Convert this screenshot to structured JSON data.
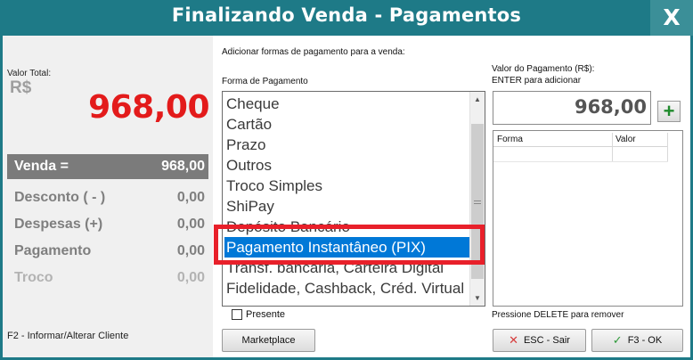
{
  "window": {
    "title": "Finalizando Venda - Pagamentos",
    "close_label": "X",
    "accent_color": "#1e7a87"
  },
  "left": {
    "total_label": "Valor Total:",
    "currency": "R$",
    "total_value": "968,00",
    "venda": {
      "label": "Venda =",
      "value": "968,00"
    },
    "desconto": {
      "label": "Desconto ( - )",
      "value": "0,00"
    },
    "despesas": {
      "label": "Despesas (+)",
      "value": "0,00"
    },
    "pagamento": {
      "label": "Pagamento",
      "value": "0,00"
    },
    "troco": {
      "label": "Troco",
      "value": "0,00"
    },
    "f2_hint": "F2 - Informar/Alterar Cliente"
  },
  "middle": {
    "add_label": "Adicionar formas de pagamento para a venda:",
    "forma_label": "Forma de Pagamento",
    "methods": [
      "Cheque",
      "Cartão",
      "Prazo",
      "Outros",
      "Troco Simples",
      "ShiPay",
      "Depósito Bancário",
      "Pagamento Instantâneo (PIX)",
      "Transf. bancária, Carteira Digital",
      "Fidelidade, Cashback, Créd. Virtual"
    ],
    "selected_method": "Pagamento Instantâneo (PIX)",
    "presente_label": "Presente",
    "marketplace_label": "Marketplace"
  },
  "right": {
    "valor_label": "Valor do Pagamento (R$):",
    "enter_hint": "ENTER para adicionar",
    "valor_value": "968,00",
    "add_button": "+",
    "grid_headers": [
      "Forma",
      "Valor"
    ],
    "delete_hint": "Pressione DELETE para remover",
    "esc_label": "ESC - Sair",
    "ok_label": "F3 - OK"
  }
}
